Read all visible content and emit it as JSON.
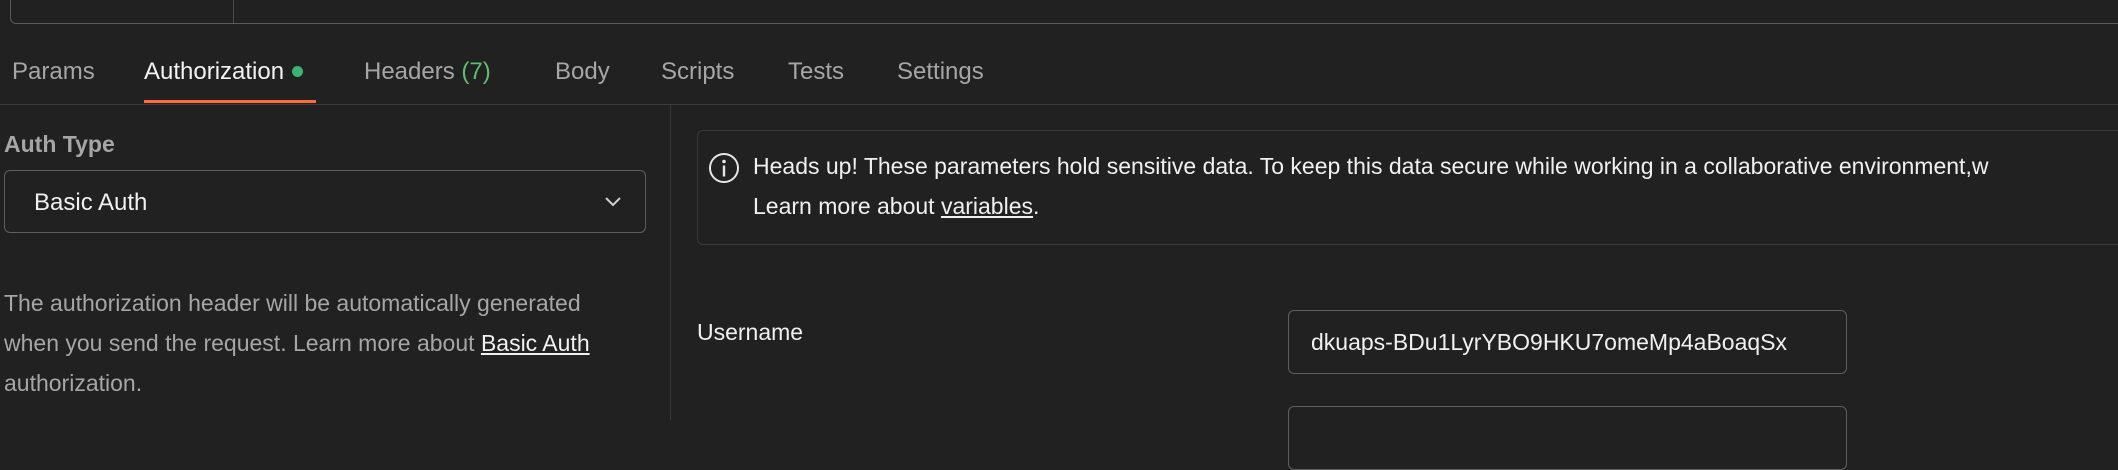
{
  "tabs": [
    {
      "label": "Params",
      "active": false
    },
    {
      "label": "Authorization",
      "active": true,
      "indicator": "modified-dot"
    },
    {
      "label": "Headers",
      "count": "(7)",
      "active": false
    },
    {
      "label": "Body",
      "active": false
    },
    {
      "label": "Scripts",
      "active": false
    },
    {
      "label": "Tests",
      "active": false
    },
    {
      "label": "Settings",
      "active": false
    }
  ],
  "auth": {
    "type_label": "Auth Type",
    "selected": "Basic Auth",
    "desc_prefix": "The authorization header will be automatically generated when you send the request. Learn more about ",
    "desc_link": "Basic Auth",
    "desc_suffix": " authorization."
  },
  "notice": {
    "icon": "info-icon",
    "line1": "Heads up! These parameters hold sensitive data. To keep this data secure while working in a collaborative environment,w",
    "line2_prefix": "Learn more about ",
    "line2_link": "variables",
    "line2_suffix": "."
  },
  "fields": {
    "username_label": "Username",
    "username_value": "dkuaps-BDu1LyrYBO9HKU7omeMp4aBoaqSx"
  },
  "colors": {
    "accent": "#ff6c37",
    "modified_dot": "#3cb371",
    "count": "#5fbf6f",
    "background": "#212121"
  }
}
